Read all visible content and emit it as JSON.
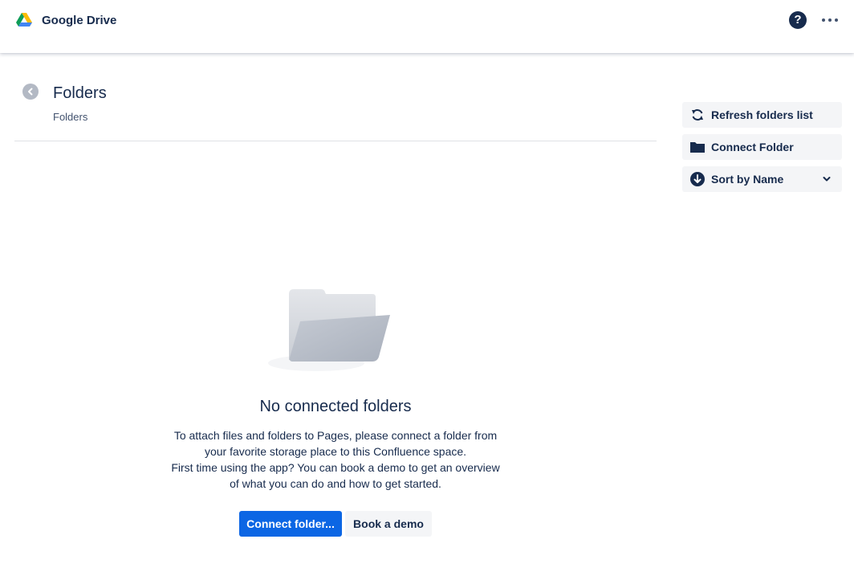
{
  "header": {
    "app_title": "Google Drive",
    "logo_icon": "google-drive-icon",
    "help_icon": "question-circle-icon",
    "help_glyph": "?",
    "more_icon": "more-horizontal-icon"
  },
  "page": {
    "title": "Folders",
    "breadcrumb": "Folders",
    "back_icon": "chevron-left-circle-icon"
  },
  "sidebar_actions": [
    {
      "label": "Refresh folders list",
      "icon": "refresh-icon"
    },
    {
      "label": "Connect Folder",
      "icon": "folder-icon"
    },
    {
      "label": "Sort by Name",
      "icon": "arrow-down-circle-icon",
      "dropdown_icon": "chevron-down-icon"
    }
  ],
  "empty_state": {
    "illustration": "empty-folder-illustration",
    "title": "No connected folders",
    "description_lines": [
      "To attach files and folders to Pages, please connect a folder from",
      "your favorite storage place to this Confluence space.",
      "First time using the app? You can book a demo to get an overview",
      "of what you can do and how to get started."
    ],
    "primary_button": "Connect folder...",
    "secondary_button": "Book a demo"
  },
  "colors": {
    "primary": "#0C66E4",
    "text": "#172B4D",
    "subtle_bg": "#F4F5F7"
  }
}
